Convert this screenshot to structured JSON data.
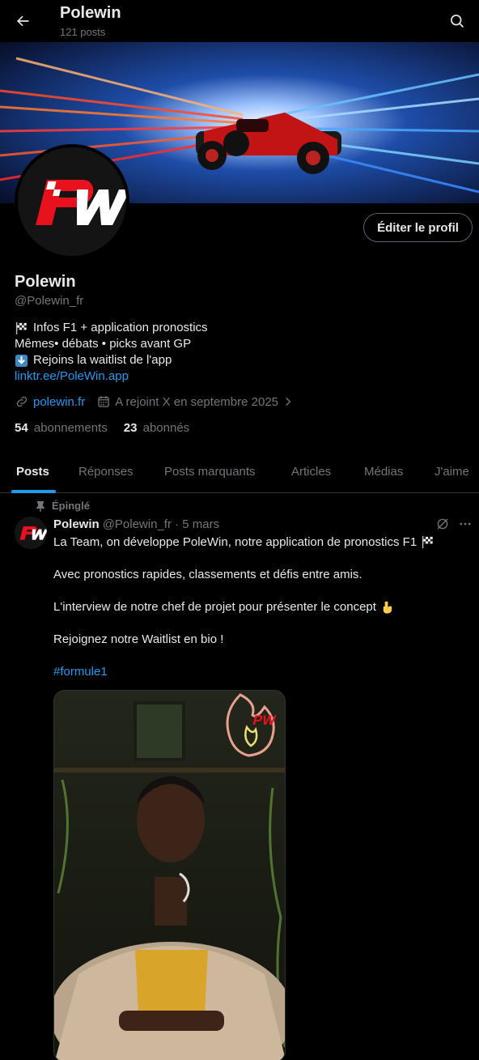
{
  "header": {
    "title": "Polewin",
    "subtitle": "121 posts"
  },
  "profile": {
    "name": "Polewin",
    "handle": "@Polewin_fr",
    "edit_button": "Éditer le profil",
    "avatar_logo": "PW",
    "bio": {
      "line1": "Infos F1 + application pronostics",
      "line2": "Mêmes• débats • picks avant GP",
      "line3": "Rejoins la waitlist de l'app",
      "link": "linktr.ee/PoleWin.app"
    },
    "website": "polewin.fr",
    "joined": "A rejoint X en septembre 2025",
    "following_count": "54",
    "following_label": "abonnements",
    "followers_count": "23",
    "followers_label": "abonnés"
  },
  "tabs": [
    "Posts",
    "Réponses",
    "Posts marquants",
    "Articles",
    "Médias",
    "J'aime"
  ],
  "post": {
    "pinned_label": "Épinglé",
    "author": "Polewin",
    "handle_date": "@Polewin_fr · 5 mars",
    "line1": "La Team, on développe PoleWin, notre application de pronostics F1",
    "line2": "Avec pronostics rapides, classements et défis entre amis.",
    "line3": "L'interview de notre chef de projet pour présenter le concept",
    "line4": "Rejoignez notre Waitlist en bio !",
    "hashtag": "#formule1",
    "media_logo": "PW"
  },
  "icons": {
    "back": "arrow-left-icon",
    "search": "search-icon",
    "checkered_flag": "checkered-flag-icon",
    "down_arrow": "down-arrow-icon",
    "link": "link-icon",
    "calendar": "calendar-icon",
    "pin": "pin-icon",
    "pointing_down": "pointing-down-emoji",
    "more": "more-icon"
  },
  "colors": {
    "accent": "#1d9bf0",
    "logo_red": "#e8121e",
    "background": "#000000"
  }
}
